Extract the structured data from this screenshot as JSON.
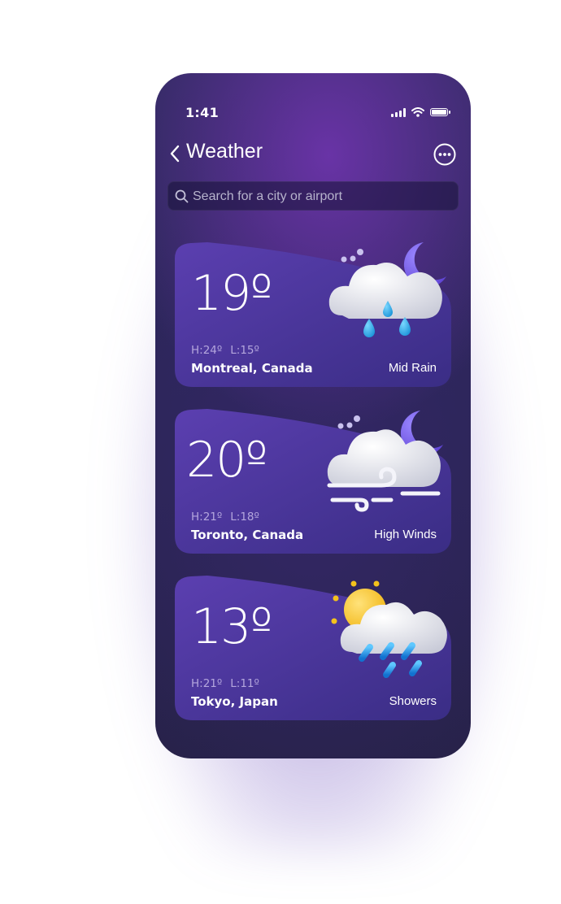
{
  "status_bar": {
    "time": "1:41"
  },
  "header": {
    "title": "Weather"
  },
  "search": {
    "placeholder": "Search for a city or airport"
  },
  "cities": [
    {
      "temperature": "19º",
      "high": "H:24º",
      "low": "L:15º",
      "name": "Montreal, Canada",
      "condition": "Mid Rain",
      "icon": "moon-cloud-rain-icon"
    },
    {
      "temperature": "20º",
      "high": "H:21º",
      "low": "L:18º",
      "name": "Toronto, Canada",
      "condition": "High Winds",
      "icon": "moon-cloud-wind-icon"
    },
    {
      "temperature": "13º",
      "high": "H:21º",
      "low": "L:11º",
      "name": "Tokyo, Japan",
      "condition": "Showers",
      "icon": "sun-cloud-showers-icon"
    }
  ],
  "colors": {
    "card_top": "#5b3fb0",
    "card_bottom": "#3a2d85",
    "background": "#2b2658",
    "accent_moon": "#7a5ce8",
    "rain_drop": "#2aa8e8",
    "sun": "#f4c21c"
  }
}
